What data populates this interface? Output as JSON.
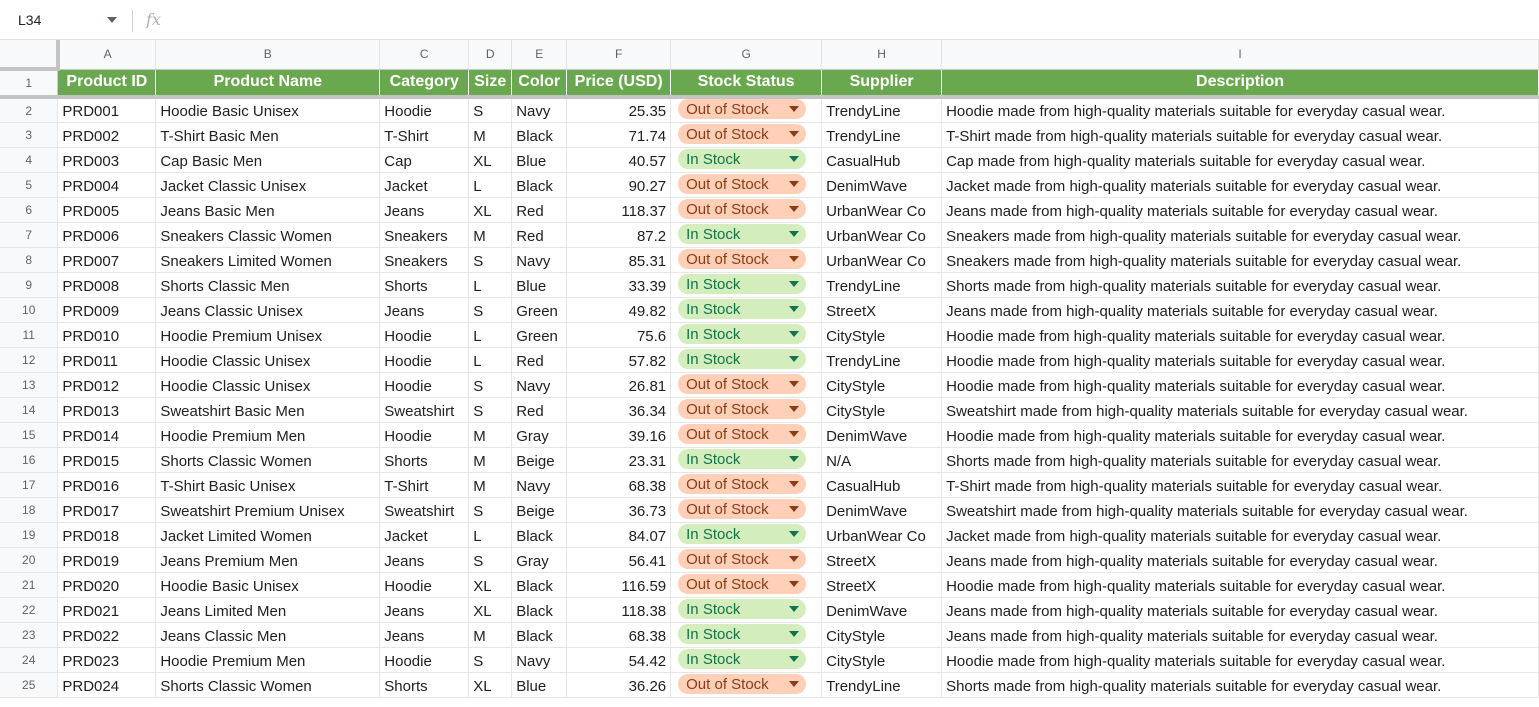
{
  "name_box": {
    "cell": "L34"
  },
  "formula_bar": {
    "fx_label": "fx",
    "value": ""
  },
  "columns": [
    "A",
    "B",
    "C",
    "D",
    "E",
    "F",
    "G",
    "H",
    "I"
  ],
  "header_row_number": "1",
  "headers": [
    "Product ID",
    "Product Name",
    "Category",
    "Size",
    "Color",
    "Price (USD)",
    "Stock Status",
    "Supplier",
    "Description"
  ],
  "status_colors": {
    "out_of_stock": "#ffcfb8",
    "in_stock": "#d4edbc",
    "header_bg": "#6aa84f"
  },
  "rows": [
    {
      "n": "2",
      "id": "PRD001",
      "name": "Hoodie Basic Unisex",
      "cat": "Hoodie",
      "size": "S",
      "color": "Navy",
      "price": "25.35",
      "status": "Out of Stock",
      "supplier": "TrendyLine",
      "desc": "Hoodie made from high-quality materials suitable for everyday casual wear."
    },
    {
      "n": "3",
      "id": "PRD002",
      "name": "T-Shirt Basic Men",
      "cat": "T-Shirt",
      "size": "M",
      "color": "Black",
      "price": "71.74",
      "status": "Out of Stock",
      "supplier": "TrendyLine",
      "desc": "T-Shirt made from high-quality materials suitable for everyday casual wear."
    },
    {
      "n": "4",
      "id": "PRD003",
      "name": "Cap Basic Men",
      "cat": "Cap",
      "size": "XL",
      "color": "Blue",
      "price": "40.57",
      "status": "In Stock",
      "supplier": "CasualHub",
      "desc": "Cap made from high-quality materials suitable for everyday casual wear."
    },
    {
      "n": "5",
      "id": "PRD004",
      "name": "Jacket Classic Unisex",
      "cat": "Jacket",
      "size": "L",
      "color": "Black",
      "price": "90.27",
      "status": "Out of Stock",
      "supplier": "DenimWave",
      "desc": "Jacket made from high-quality materials suitable for everyday casual wear."
    },
    {
      "n": "6",
      "id": "PRD005",
      "name": "Jeans Basic Men",
      "cat": "Jeans",
      "size": "XL",
      "color": "Red",
      "price": "118.37",
      "status": "Out of Stock",
      "supplier": "UrbanWear Co",
      "desc": "Jeans made from high-quality materials suitable for everyday casual wear."
    },
    {
      "n": "7",
      "id": "PRD006",
      "name": "Sneakers Classic Women",
      "cat": "Sneakers",
      "size": "M",
      "color": "Red",
      "price": "87.2",
      "status": "In Stock",
      "supplier": "UrbanWear Co",
      "desc": "Sneakers made from high-quality materials suitable for everyday casual wear."
    },
    {
      "n": "8",
      "id": "PRD007",
      "name": "Sneakers Limited Women",
      "cat": "Sneakers",
      "size": "S",
      "color": "Navy",
      "price": "85.31",
      "status": "Out of Stock",
      "supplier": "UrbanWear Co",
      "desc": "Sneakers made from high-quality materials suitable for everyday casual wear."
    },
    {
      "n": "9",
      "id": "PRD008",
      "name": "Shorts Classic Men",
      "cat": "Shorts",
      "size": "L",
      "color": "Blue",
      "price": "33.39",
      "status": "In Stock",
      "supplier": "TrendyLine",
      "desc": "Shorts made from high-quality materials suitable for everyday casual wear."
    },
    {
      "n": "10",
      "id": "PRD009",
      "name": "Jeans Classic Unisex",
      "cat": "Jeans",
      "size": "S",
      "color": "Green",
      "price": "49.82",
      "status": "In Stock",
      "supplier": "StreetX",
      "desc": "Jeans made from high-quality materials suitable for everyday casual wear."
    },
    {
      "n": "11",
      "id": "PRD010",
      "name": "Hoodie Premium Unisex",
      "cat": "Hoodie",
      "size": "L",
      "color": "Green",
      "price": "75.6",
      "status": "In Stock",
      "supplier": "CityStyle",
      "desc": "Hoodie made from high-quality materials suitable for everyday casual wear."
    },
    {
      "n": "12",
      "id": "PRD011",
      "name": "Hoodie Classic Unisex",
      "cat": "Hoodie",
      "size": "L",
      "color": "Red",
      "price": "57.82",
      "status": "In Stock",
      "supplier": "TrendyLine",
      "desc": "Hoodie made from high-quality materials suitable for everyday casual wear."
    },
    {
      "n": "13",
      "id": "PRD012",
      "name": "Hoodie Classic Unisex",
      "cat": "Hoodie",
      "size": "S",
      "color": "Navy",
      "price": "26.81",
      "status": "Out of Stock",
      "supplier": "CityStyle",
      "desc": "Hoodie made from high-quality materials suitable for everyday casual wear."
    },
    {
      "n": "14",
      "id": "PRD013",
      "name": "Sweatshirt Basic Men",
      "cat": "Sweatshirt",
      "size": "S",
      "color": "Red",
      "price": "36.34",
      "status": "Out of Stock",
      "supplier": "CityStyle",
      "desc": "Sweatshirt made from high-quality materials suitable for everyday casual wear."
    },
    {
      "n": "15",
      "id": "PRD014",
      "name": "Hoodie Premium Men",
      "cat": "Hoodie",
      "size": "M",
      "color": "Gray",
      "price": "39.16",
      "status": "Out of Stock",
      "supplier": "DenimWave",
      "desc": "Hoodie made from high-quality materials suitable for everyday casual wear."
    },
    {
      "n": "16",
      "id": "PRD015",
      "name": "Shorts Classic Women",
      "cat": "Shorts",
      "size": "M",
      "color": "Beige",
      "price": "23.31",
      "status": "In Stock",
      "supplier": "N/A",
      "desc": "Shorts made from high-quality materials suitable for everyday casual wear."
    },
    {
      "n": "17",
      "id": "PRD016",
      "name": "T-Shirt Basic Unisex",
      "cat": "T-Shirt",
      "size": "M",
      "color": "Navy",
      "price": "68.38",
      "status": "Out of Stock",
      "supplier": "CasualHub",
      "desc": "T-Shirt made from high-quality materials suitable for everyday casual wear."
    },
    {
      "n": "18",
      "id": "PRD017",
      "name": "Sweatshirt Premium Unisex",
      "cat": "Sweatshirt",
      "size": "S",
      "color": "Beige",
      "price": "36.73",
      "status": "Out of Stock",
      "supplier": "DenimWave",
      "desc": "Sweatshirt made from high-quality materials suitable for everyday casual wear."
    },
    {
      "n": "19",
      "id": "PRD018",
      "name": "Jacket Limited Women",
      "cat": "Jacket",
      "size": "L",
      "color": "Black",
      "price": "84.07",
      "status": "In Stock",
      "supplier": "UrbanWear Co",
      "desc": "Jacket made from high-quality materials suitable for everyday casual wear."
    },
    {
      "n": "20",
      "id": "PRD019",
      "name": "Jeans Premium Men",
      "cat": "Jeans",
      "size": "S",
      "color": "Gray",
      "price": "56.41",
      "status": "Out of Stock",
      "supplier": "StreetX",
      "desc": "Jeans made from high-quality materials suitable for everyday casual wear."
    },
    {
      "n": "21",
      "id": "PRD020",
      "name": "Hoodie Basic Unisex",
      "cat": "Hoodie",
      "size": "XL",
      "color": "Black",
      "price": "116.59",
      "status": "Out of Stock",
      "supplier": "StreetX",
      "desc": "Hoodie made from high-quality materials suitable for everyday casual wear."
    },
    {
      "n": "22",
      "id": "PRD021",
      "name": "Jeans Limited Men",
      "cat": "Jeans",
      "size": "XL",
      "color": "Black",
      "price": "118.38",
      "status": "In Stock",
      "supplier": "DenimWave",
      "desc": "Jeans made from high-quality materials suitable for everyday casual wear."
    },
    {
      "n": "23",
      "id": "PRD022",
      "name": "Jeans Classic Men",
      "cat": "Jeans",
      "size": "M",
      "color": "Black",
      "price": "68.38",
      "status": "In Stock",
      "supplier": "CityStyle",
      "desc": "Jeans made from high-quality materials suitable for everyday casual wear."
    },
    {
      "n": "24",
      "id": "PRD023",
      "name": "Hoodie Premium Men",
      "cat": "Hoodie",
      "size": "S",
      "color": "Navy",
      "price": "54.42",
      "status": "In Stock",
      "supplier": "CityStyle",
      "desc": "Hoodie made from high-quality materials suitable for everyday casual wear."
    },
    {
      "n": "25",
      "id": "PRD024",
      "name": "Shorts Classic Women",
      "cat": "Shorts",
      "size": "XL",
      "color": "Blue",
      "price": "36.26",
      "status": "Out of Stock",
      "supplier": "TrendyLine",
      "desc": "Shorts made from high-quality materials suitable for everyday casual wear."
    }
  ]
}
